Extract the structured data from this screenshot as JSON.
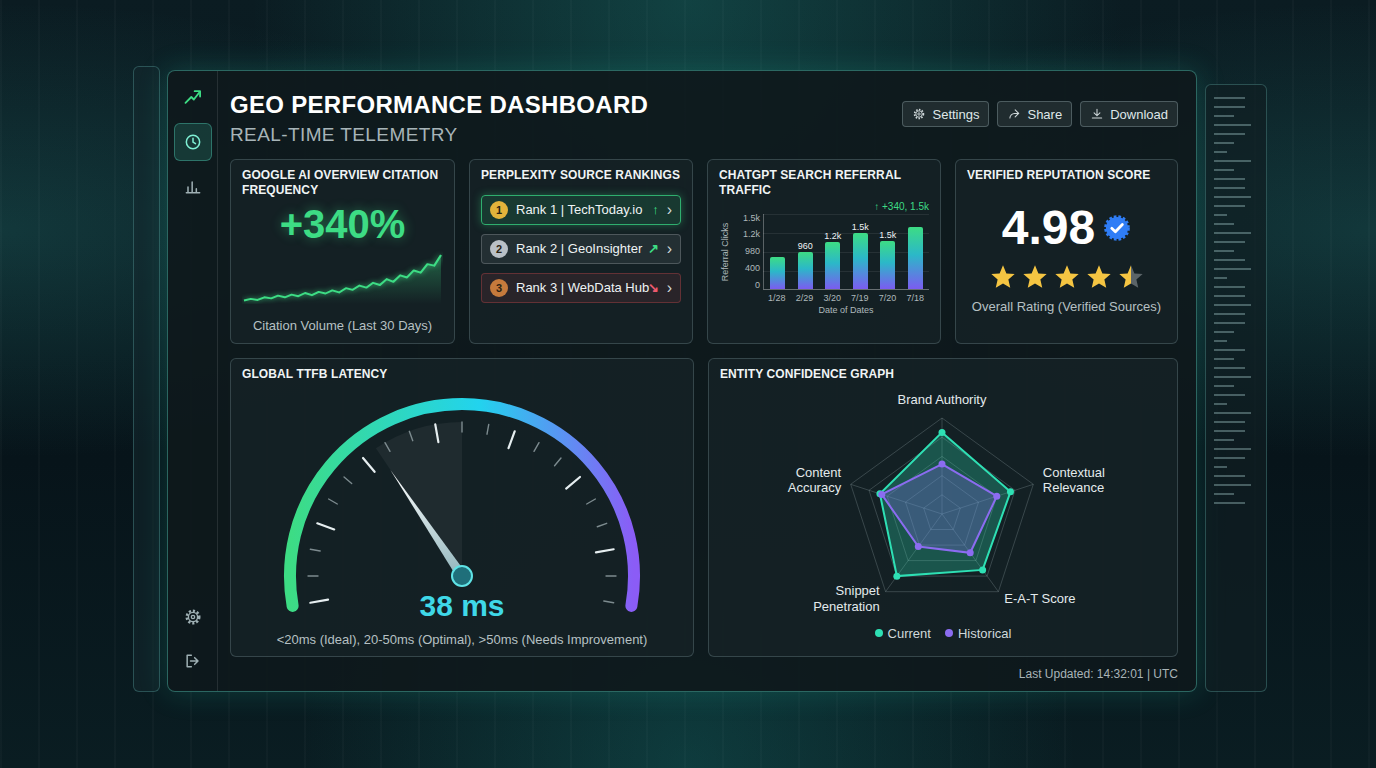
{
  "window": {
    "title": "GEO PERFORMANCE DASHBOARD",
    "subtitle": "REAL-TIME TELEMETRY"
  },
  "toolbar": {
    "buttons": [
      {
        "label": "Settings",
        "kind": "settings"
      },
      {
        "label": "Share",
        "kind": "share"
      },
      {
        "label": "Download",
        "kind": "download"
      }
    ]
  },
  "sidebar": {
    "top_items": [
      {
        "kind": "logo",
        "selected": false
      },
      {
        "kind": "history",
        "selected": true
      },
      {
        "kind": "analytics",
        "selected": false
      }
    ],
    "bottom_items": [
      {
        "kind": "settings",
        "selected": false
      },
      {
        "kind": "logout",
        "selected": false
      }
    ]
  },
  "citation": {
    "title": "GOOGLE AI OVERVIEW CITATION FREQUENCY",
    "value": "+340%",
    "caption": "Citation Volume (Last 30 Days)",
    "series": [
      10,
      13,
      11,
      16,
      14,
      19,
      16,
      21,
      18,
      24,
      20,
      26,
      23,
      29,
      25,
      33,
      30,
      38,
      34,
      43,
      39,
      50,
      45,
      57,
      53,
      66,
      62,
      78,
      75,
      95
    ]
  },
  "rankings": {
    "title": "PERPLEXITY SOURCE RANKINGS",
    "chevron": "›",
    "items": [
      {
        "rank": "1",
        "label": "Rank 1 | TechToday.io",
        "trend": "↑",
        "trend_color": "#3ddc84",
        "medal_color": "#e3b33b",
        "color": "#2fae6e",
        "selected": true
      },
      {
        "rank": "2",
        "label": "Rank 2 | GeoInsighter",
        "trend": "↗",
        "trend_color": "#3ddc84",
        "medal_color": "#b9c0c6",
        "color": "#6b7378",
        "selected": false
      },
      {
        "rank": "3",
        "label": "Rank 3 | WebData Hub",
        "trend": "↘",
        "trend_color": "#ef5a6f",
        "medal_color": "#c57a3c",
        "color": "#8a3a40",
        "selected": false
      }
    ]
  },
  "traffic": {
    "title": "CHATGPT SEARCH REFERRAL TRAFFIC",
    "annotation": "↑ +340, 1.5k",
    "y_axis_title": "Referral Clicks",
    "x_axis_title": "Date of Dates",
    "y_ticks": [
      "1.5k",
      "1.2k",
      "980",
      "400",
      "0"
    ],
    "categories": [
      "1/28",
      "2/29",
      "3/20",
      "7/19",
      "7/20",
      "7/18"
    ],
    "bar_labels": [
      "",
      "960",
      "1.2k",
      "1.5k",
      "1.5k",
      ""
    ],
    "series": [
      {
        "name": "Referral Clicks",
        "values": [
          820,
          960,
          1200,
          1450,
          1250,
          1600
        ]
      }
    ]
  },
  "reputation": {
    "title": "VERIFIED REPUTATION SCORE",
    "value": "4.98",
    "verified": true,
    "stars": 4.5,
    "max_stars": 5,
    "caption": "Overall Rating (Verified Sources)"
  },
  "latency": {
    "title": "GLOBAL TTFB LATENCY",
    "value": "38 ms",
    "level": 0.33,
    "legend": "<20ms (Ideal), 20-50ms (Optimal), >50ms (Needs Improvement)"
  },
  "entity": {
    "title": "ENTITY CONFIDENCE GRAPH",
    "axes": [
      "Brand Authority",
      "Contextual Relevance",
      "E-A-T Score",
      "Snippet Penetration",
      "Content Accuracy"
    ],
    "series": [
      {
        "name": "Current",
        "color": "#2ee0b4",
        "values": [
          0.85,
          0.75,
          0.72,
          0.8,
          0.68
        ]
      },
      {
        "name": "Historical",
        "color": "#8b6cf0",
        "values": [
          0.52,
          0.6,
          0.5,
          0.42,
          0.66
        ]
      }
    ]
  },
  "status_bar": {
    "text": "Last Updated: 14:32:01 | UTC"
  }
}
